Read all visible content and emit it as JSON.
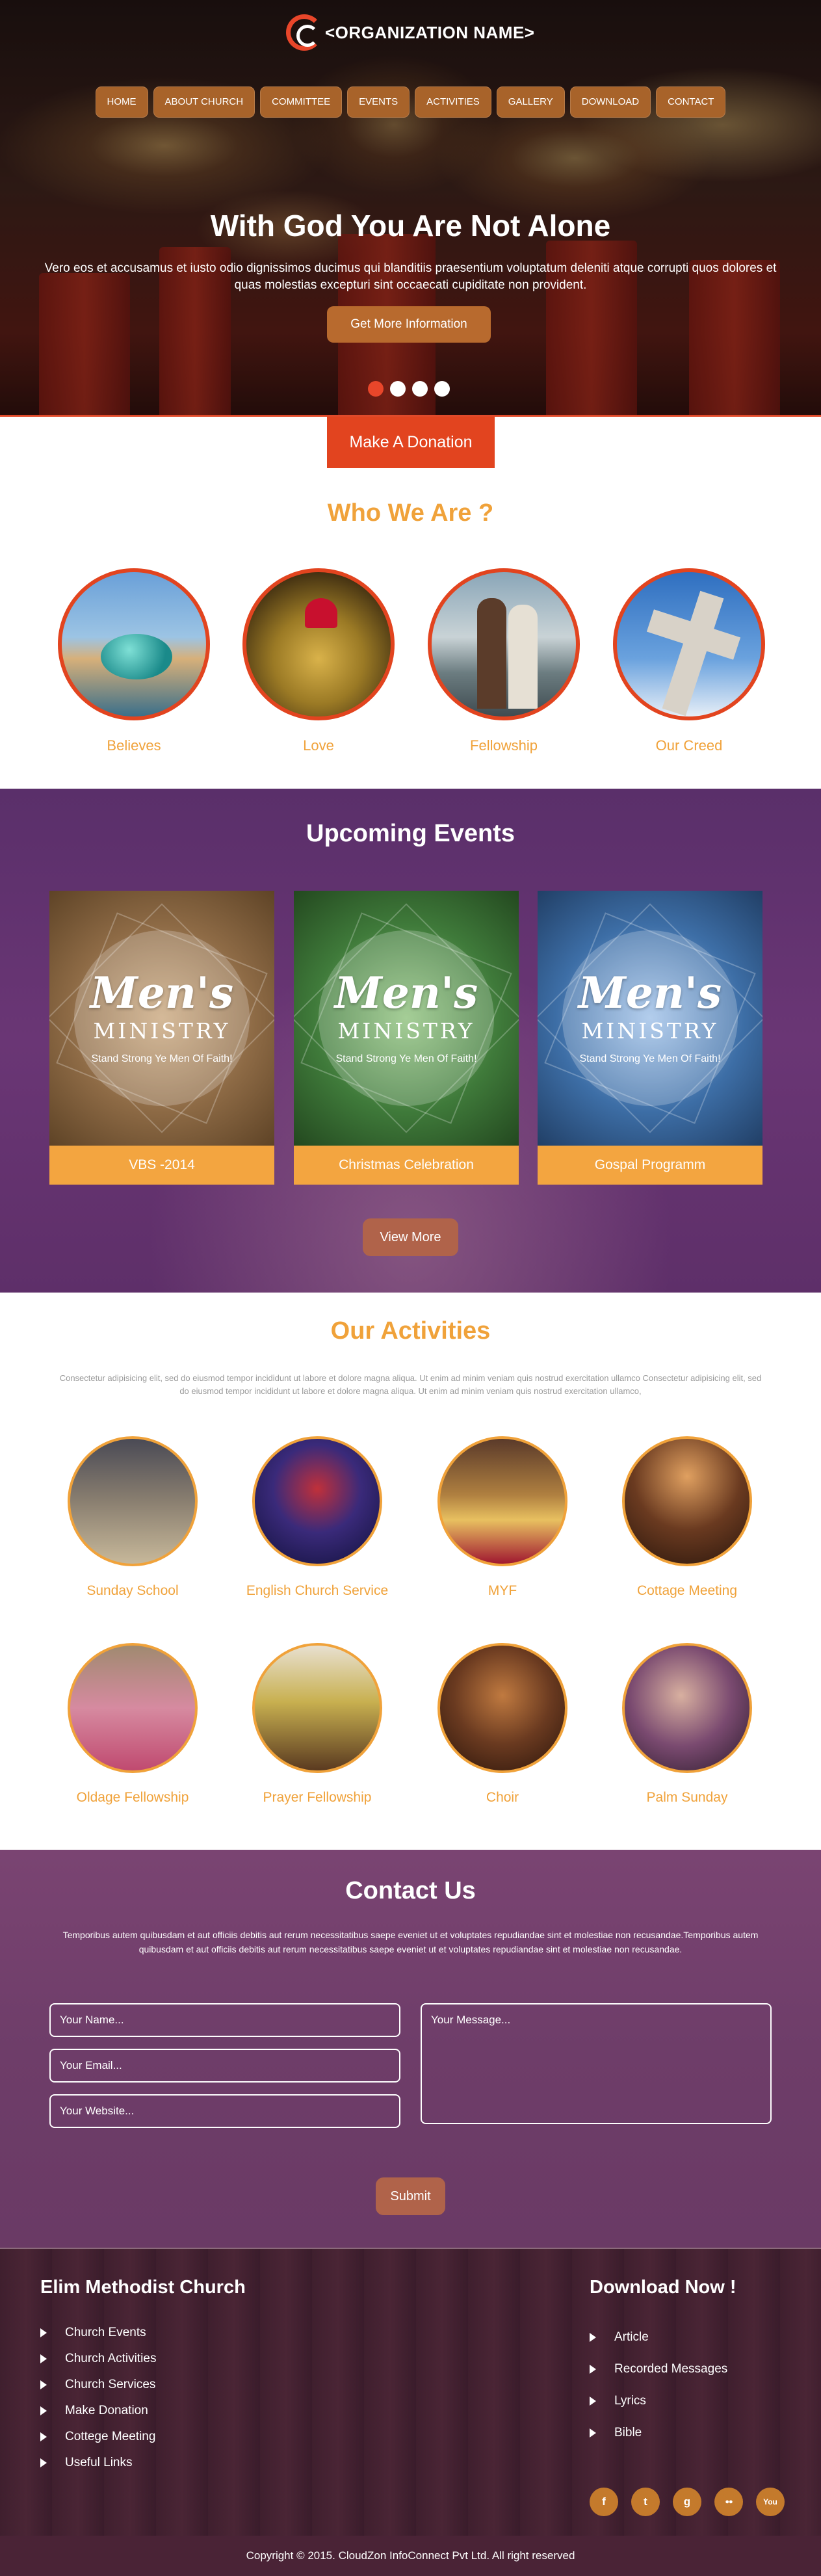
{
  "header": {
    "logo_text": "<ORGANIZATION NAME>",
    "nav": [
      "HOME",
      "ABOUT CHURCH",
      "COMMITTEE",
      "EVENTS",
      "ACTIVITIES",
      "GALLERY",
      "DOWNLOAD",
      "CONTACT"
    ]
  },
  "hero": {
    "title": "With God You Are Not Alone",
    "text": "Vero eos et accusamus et iusto odio dignissimos ducimus qui blanditiis praesentium voluptatum deleniti atque corrupti quos dolores et quas molestias excepturi sint occaecati cupiditate non provident.",
    "button": "Get More Information",
    "slides": 4,
    "active_slide": 1
  },
  "donate": {
    "label": "Make A Donation"
  },
  "who": {
    "title": "Who We Are ?",
    "items": [
      {
        "label": "Believes",
        "icon": "believe-stone-image"
      },
      {
        "label": "Love",
        "icon": "love-jesus-image"
      },
      {
        "label": "Fellowship",
        "icon": "fellowship-image"
      },
      {
        "label": "Our Creed",
        "icon": "cross-image"
      }
    ]
  },
  "events": {
    "title": "Upcoming Events",
    "poster_title": "Men's",
    "poster_sub": "MINISTRY",
    "poster_tag": "Stand Strong Ye Men Of Faith!",
    "cards": [
      {
        "caption": "VBS -2014",
        "color": "#8d6a45"
      },
      {
        "caption": "Christmas Celebration",
        "color": "#3f7a3a"
      },
      {
        "caption": "Gospal Programm",
        "color": "#3d6ea6"
      }
    ],
    "view_more": "View More"
  },
  "activities": {
    "title": "Our Activities",
    "text": "Consectetur adipisicing elit, sed do eiusmod tempor incididunt ut labore et dolore magna aliqua. Ut enim ad minim veniam quis nostrud exercitation ullamco Consectetur adipisicing elit, sed do eiusmod tempor incididunt ut labore et dolore magna aliqua. Ut enim ad minim veniam quis nostrud exercitation ullamco,",
    "items": [
      "Sunday School",
      "English Church Service",
      "MYF",
      "Cottage Meeting",
      "Oldage Fellowship",
      "Prayer Fellowship",
      "Choir",
      "Palm Sunday"
    ]
  },
  "contact": {
    "title": "Contact Us",
    "text": "Temporibus autem quibusdam et aut officiis debitis aut rerum necessitatibus saepe eveniet ut et voluptates repudiandae sint et molestiae non recusandae.Temporibus autem quibusdam et aut officiis debitis aut rerum necessitatibus saepe eveniet ut et voluptates repudiandae sint et molestiae non recusandae.",
    "name_placeholder": "Your Name...",
    "email_placeholder": "Your Email...",
    "website_placeholder": "Your Website...",
    "message_placeholder": "Your Message...",
    "submit": "Submit"
  },
  "footer": {
    "left_title": "Elim Methodist Church",
    "left_links": [
      "Church Events",
      "Church Activities",
      "Church Services",
      "Make Donation",
      "Cottege Meeting",
      "Useful Links"
    ],
    "right_title": "Download Now !",
    "right_links": [
      "Article",
      "Recorded Messages",
      "Lyrics",
      "Bible"
    ],
    "social": [
      "f",
      "t",
      "g",
      "●●",
      "You"
    ],
    "copyright": "Copyright © 2015. CloudZon InfoConnect Pvt Ltd. All right reserved"
  },
  "colors": {
    "accent": "#e2441f",
    "orange": "#f0a23a",
    "button": "#b0634a",
    "purple": "#6a3675"
  }
}
